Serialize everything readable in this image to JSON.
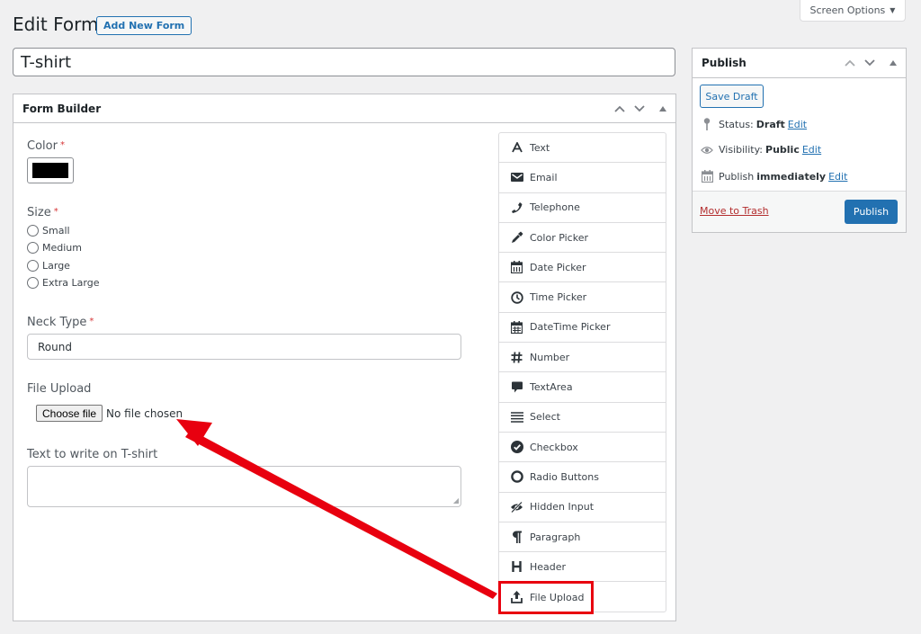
{
  "screen_options": {
    "label": "Screen Options",
    "caret": "▼"
  },
  "header": {
    "title": "Edit Form",
    "add_new_label": "Add New Form"
  },
  "form_title": {
    "value": "T-shirt"
  },
  "form_builder": {
    "title": "Form Builder",
    "fields": {
      "color": {
        "label": "Color",
        "required": "*",
        "value": "#000000"
      },
      "size": {
        "label": "Size",
        "required": "*",
        "options": [
          "Small",
          "Medium",
          "Large",
          "Extra Large"
        ]
      },
      "neck_type": {
        "label": "Neck Type",
        "required": "*",
        "value": "Round"
      },
      "file_upload": {
        "label": "File Upload",
        "button": "Choose file",
        "status": "No file chosen"
      },
      "text_to_write": {
        "label": "Text to write on T-shirt",
        "value": ""
      }
    },
    "palette": [
      {
        "label": "Text",
        "icon": "text-icon"
      },
      {
        "label": "Email",
        "icon": "email-icon"
      },
      {
        "label": "Telephone",
        "icon": "phone-icon"
      },
      {
        "label": "Color Picker",
        "icon": "eyedropper-icon"
      },
      {
        "label": "Date Picker",
        "icon": "calendar-icon"
      },
      {
        "label": "Time Picker",
        "icon": "clock-icon"
      },
      {
        "label": "DateTime Picker",
        "icon": "calendar-grid-icon"
      },
      {
        "label": "Number",
        "icon": "hash-icon"
      },
      {
        "label": "TextArea",
        "icon": "comment-icon"
      },
      {
        "label": "Select",
        "icon": "list-icon"
      },
      {
        "label": "Checkbox",
        "icon": "check-circle-icon"
      },
      {
        "label": "Radio Buttons",
        "icon": "circle-icon"
      },
      {
        "label": "Hidden Input",
        "icon": "eye-slash-icon"
      },
      {
        "label": "Paragraph",
        "icon": "paragraph-icon"
      },
      {
        "label": "Header",
        "icon": "heading-icon"
      },
      {
        "label": "File Upload",
        "icon": "upload-icon"
      }
    ]
  },
  "publish": {
    "title": "Publish",
    "save_draft": "Save Draft",
    "status_label": "Status:",
    "status_value": "Draft",
    "visibility_label": "Visibility:",
    "visibility_value": "Public",
    "schedule_label": "Publish",
    "schedule_value": "immediately",
    "edit_link": "Edit",
    "trash_label": "Move to Trash",
    "publish_label": "Publish"
  },
  "annotation": {
    "color": "#e8000f"
  }
}
